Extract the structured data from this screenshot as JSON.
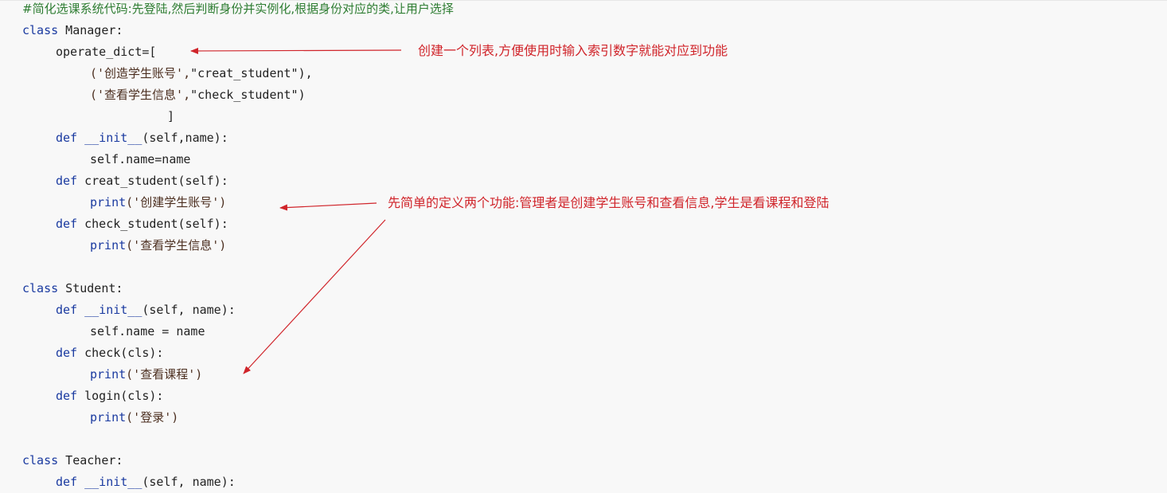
{
  "code": {
    "comment": "#简化选课系统代码:先登陆,然后判断身份并实例化,根据身份对应的类,让用户选择",
    "kw_class": "class",
    "kw_def": "def",
    "kw_print": "print",
    "manager_class": " Manager:",
    "operate_dict": "operate_dict=[",
    "tuple1_a": "('创造学生账号',",
    "tuple1_b": "\"creat_student\"),",
    "tuple2_a": "('查看学生信息',",
    "tuple2_b": "\"check_student\")",
    "bracket_close": "]",
    "init": " __init__",
    "init_args_manager": "(self,name):",
    "self_name_manager": "self.name=name",
    "creat_student_def": " creat_student(self):",
    "print_creat": "('创建学生账号')",
    "check_student_def": " check_student(self):",
    "print_check_info": "('查看学生信息')",
    "student_class": " Student:",
    "init_args": "(self, name):",
    "self_name": "self.name = name",
    "check_def": " check(cls):",
    "print_course": "('查看课程')",
    "login_def": " login(cls):",
    "print_login": "('登录')",
    "teacher_class": " Teacher:"
  },
  "annotations": {
    "list_note": "创建一个列表,方便使用时输入索引数字就能对应到功能",
    "func_note": "先简单的定义两个功能:管理者是创建学生账号和查看信息,学生是看课程和登陆"
  },
  "colors": {
    "annotation": "#d0242a",
    "keyword": "#1a3aa0",
    "comment": "#2e7d32",
    "background": "#f8f8f8"
  }
}
